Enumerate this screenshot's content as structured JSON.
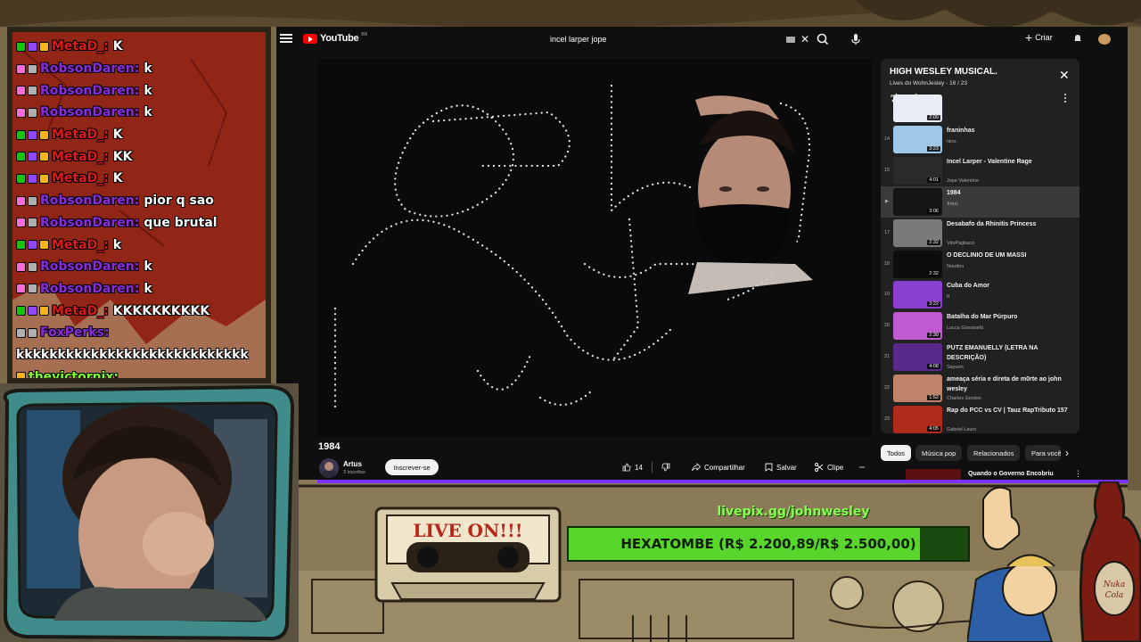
{
  "chat": {
    "messages": [
      {
        "user": "MetaD_",
        "sep": ":",
        "text": "K",
        "user_color": "#e01a1a",
        "badges": [
          "#16c60c",
          "#9146ff",
          "#ffb31a"
        ]
      },
      {
        "user": "RobsonDaren",
        "sep": ":",
        "text": "k",
        "user_color": "#8a2be2",
        "badges": [
          "#ff6bd6",
          "#b0b0b0"
        ]
      },
      {
        "user": "RobsonDaren",
        "sep": ":",
        "text": "k",
        "user_color": "#8a2be2",
        "badges": [
          "#ff6bd6",
          "#b0b0b0"
        ]
      },
      {
        "user": "RobsonDaren",
        "sep": ":",
        "text": "k",
        "user_color": "#8a2be2",
        "badges": [
          "#ff6bd6",
          "#b0b0b0"
        ]
      },
      {
        "user": "MetaD_",
        "sep": ":",
        "text": "K",
        "user_color": "#e01a1a",
        "badges": [
          "#16c60c",
          "#9146ff",
          "#ffb31a"
        ]
      },
      {
        "user": "MetaD_",
        "sep": ":",
        "text": "KK",
        "user_color": "#e01a1a",
        "badges": [
          "#16c60c",
          "#9146ff",
          "#ffb31a"
        ]
      },
      {
        "user": "MetaD_",
        "sep": ":",
        "text": "K",
        "user_color": "#e01a1a",
        "badges": [
          "#16c60c",
          "#9146ff",
          "#ffb31a"
        ]
      },
      {
        "user": "RobsonDaren",
        "sep": ":",
        "text": "pior q sao",
        "user_color": "#8a2be2",
        "badges": [
          "#ff6bd6",
          "#b0b0b0"
        ]
      },
      {
        "user": "RobsonDaren",
        "sep": ":",
        "text": "que brutal",
        "user_color": "#8a2be2",
        "badges": [
          "#ff6bd6",
          "#b0b0b0"
        ]
      },
      {
        "user": "MetaD_",
        "sep": ":",
        "text": "k",
        "user_color": "#e01a1a",
        "badges": [
          "#16c60c",
          "#9146ff",
          "#ffb31a"
        ]
      },
      {
        "user": "RobsonDaren",
        "sep": ":",
        "text": "k",
        "user_color": "#8a2be2",
        "badges": [
          "#ff6bd6",
          "#b0b0b0"
        ]
      },
      {
        "user": "RobsonDaren",
        "sep": ":",
        "text": "k",
        "user_color": "#8a2be2",
        "badges": [
          "#ff6bd6",
          "#b0b0b0"
        ]
      },
      {
        "user": "MetaD_",
        "sep": ":",
        "text": "KKKKKKKKKK",
        "user_color": "#e01a1a",
        "badges": [
          "#16c60c",
          "#9146ff",
          "#ffb31a"
        ]
      },
      {
        "user": "FoxPerks",
        "sep": ":",
        "text": "",
        "user_color": "#8a2be2",
        "badges": [
          "#b0b0b0",
          "#b0b0b0"
        ]
      },
      {
        "user": "",
        "sep": "",
        "text": "kkkkkkkkkkkkkkkkkkkkkkkkkkkk",
        "user_color": "#ffffff",
        "badges": []
      },
      {
        "user": "thevictornix",
        "sep": ":",
        "text": "",
        "user_color": "#7dff2a",
        "badges": [
          "#ffb31a"
        ]
      }
    ]
  },
  "youtube": {
    "logo_text": "YouTube",
    "logo_country": "BR",
    "search_value": "incel larper jope",
    "create_label": "Criar",
    "video_title": "1984",
    "channel_name": "Artus",
    "subscribers": "3 inscritos",
    "subscribe_label": "Inscrever-se",
    "like_count": "14",
    "share_label": "Compartilhar",
    "save_label": "Salvar",
    "clip_label": "Clipe",
    "playlist": {
      "title": "HIGH WESLEY MUSICAL.",
      "subtitle": "Lives do WohnJesley - 16 / 23",
      "items": [
        {
          "idx": "",
          "title": "",
          "channel": "",
          "duration": "2:00",
          "thumb": "#e9eef6"
        },
        {
          "idx": "14",
          "title": "franinhas",
          "channel": "nino.",
          "duration": "3:23",
          "thumb": "#9fc7e8"
        },
        {
          "idx": "15",
          "title": "Incel Larper - Valentine Rage",
          "channel": "Jope Valentine",
          "duration": "4:01",
          "thumb": "#2a2a2a"
        },
        {
          "idx": "▶",
          "title": "1984",
          "channel": "Artus",
          "duration": "3:06",
          "thumb": "#151515",
          "active": true
        },
        {
          "idx": "17",
          "title": "Desabafo da Rhinitis Princess",
          "channel": "VitoPagliacci",
          "duration": "2:32",
          "thumb": "#7a7a7a"
        },
        {
          "idx": "18",
          "title": "O DECLINIO DE UM MASSI",
          "channel": "Noudou",
          "duration": "2:32",
          "thumb": "#0d0d0d"
        },
        {
          "idx": "19",
          "title": "Cuba do Amor",
          "channel": "tt",
          "duration": "3:22",
          "thumb": "#8a3fd1"
        },
        {
          "idx": "20",
          "title": "Batalha do Mar Púrpuro",
          "channel": "Lucca Giovanetti",
          "duration": "2:30",
          "thumb": "#c05ad0"
        },
        {
          "idx": "21",
          "title": "PUTZ EMANUELLY (LETRA NA DESCRIÇÃO)",
          "channel": "Sayurin",
          "duration": "4:08",
          "thumb": "#5a2a8a"
        },
        {
          "idx": "22",
          "title": "ameaça séria e direta de m0rte ao john wesley",
          "channel": "Charles Gordon",
          "duration": "1:52",
          "thumb": "#c0836a"
        },
        {
          "idx": "23",
          "title": "Rap do PCC vs CV | Tauz RapTributo 157",
          "channel": "Gabriel Lauro",
          "duration": "4:05",
          "thumb": "#b02a1a"
        }
      ]
    },
    "chips": [
      "Todos",
      "Música pop",
      "Relacionados",
      "Para você"
    ],
    "next_rec_title": "Quando o Governo Encobriu"
  },
  "overlay": {
    "donation_link": "livepix.gg/johnwesley",
    "goal_text": "HEXATOMBE (R$ 2.200,89/R$ 2.500,00)",
    "goal_fraction": 0.88,
    "cassette_label": "LIVE ON!!!"
  },
  "colors": {
    "yt_bg": "#0f0f0f",
    "chat_bg": "#8f2416",
    "goal_fill": "#58d62c",
    "donation_link": "#86ff50",
    "accent_purple": "#7b2ff7"
  }
}
